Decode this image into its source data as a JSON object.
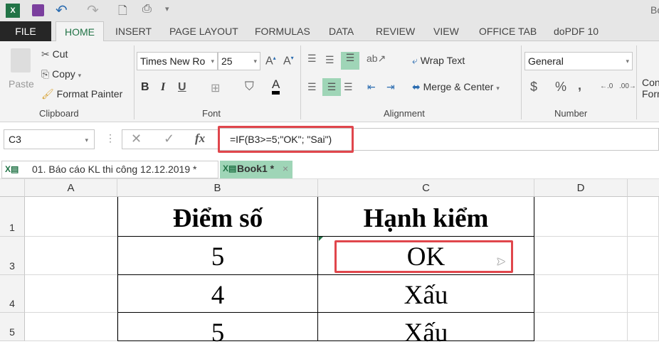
{
  "title_bar": {
    "app_partial_title": "Bo",
    "qat_icons": [
      "excel-icon",
      "save-icon",
      "undo-icon",
      "redo-icon",
      "print-preview-icon",
      "printer-icon",
      "customize-icon"
    ]
  },
  "tabs": [
    "FILE",
    "HOME",
    "INSERT",
    "PAGE LAYOUT",
    "FORMULAS",
    "DATA",
    "REVIEW",
    "VIEW",
    "OFFICE TAB",
    "doPDF 10"
  ],
  "ribbon": {
    "clipboard": {
      "paste": "Paste",
      "cut": "Cut",
      "copy": "Copy",
      "format_painter": "Format Painter",
      "label": "Clipboard"
    },
    "font": {
      "name": "Times New Ro",
      "size": "25",
      "bold": "B",
      "italic": "I",
      "underline": "U",
      "font_color": "A",
      "label": "Font"
    },
    "alignment": {
      "wrap_text": "Wrap Text",
      "merge_center": "Merge & Center",
      "label": "Alignment"
    },
    "number": {
      "format": "General",
      "currency": "$",
      "percent": "%",
      "comma": ",",
      "label": "Number"
    },
    "styles": {
      "conditional_line1": "Con",
      "conditional_line2": "Forn"
    }
  },
  "formula_bar": {
    "name_box": "C3",
    "formula": "=IF(B3>=5;\"OK\"; \"Sai\")",
    "fx": "fx"
  },
  "workbook_tabs": [
    {
      "label": "01. Báo cáo KL thi công 12.12.2019 *"
    },
    {
      "label": "Book1 *",
      "active": true
    }
  ],
  "accent": "#217346",
  "highlight": "#e0464c",
  "sheet": {
    "columns": [
      "A",
      "B",
      "C",
      "D"
    ],
    "rows": [
      {
        "num": "1",
        "b": "Điểm số",
        "c": "Hạnh kiểm"
      },
      {
        "num": "3",
        "b": "5",
        "c": "OK"
      },
      {
        "num": "4",
        "b": "4",
        "c": "Xấu"
      },
      {
        "num": "5",
        "b": "5",
        "c": "Xấu"
      }
    ]
  }
}
